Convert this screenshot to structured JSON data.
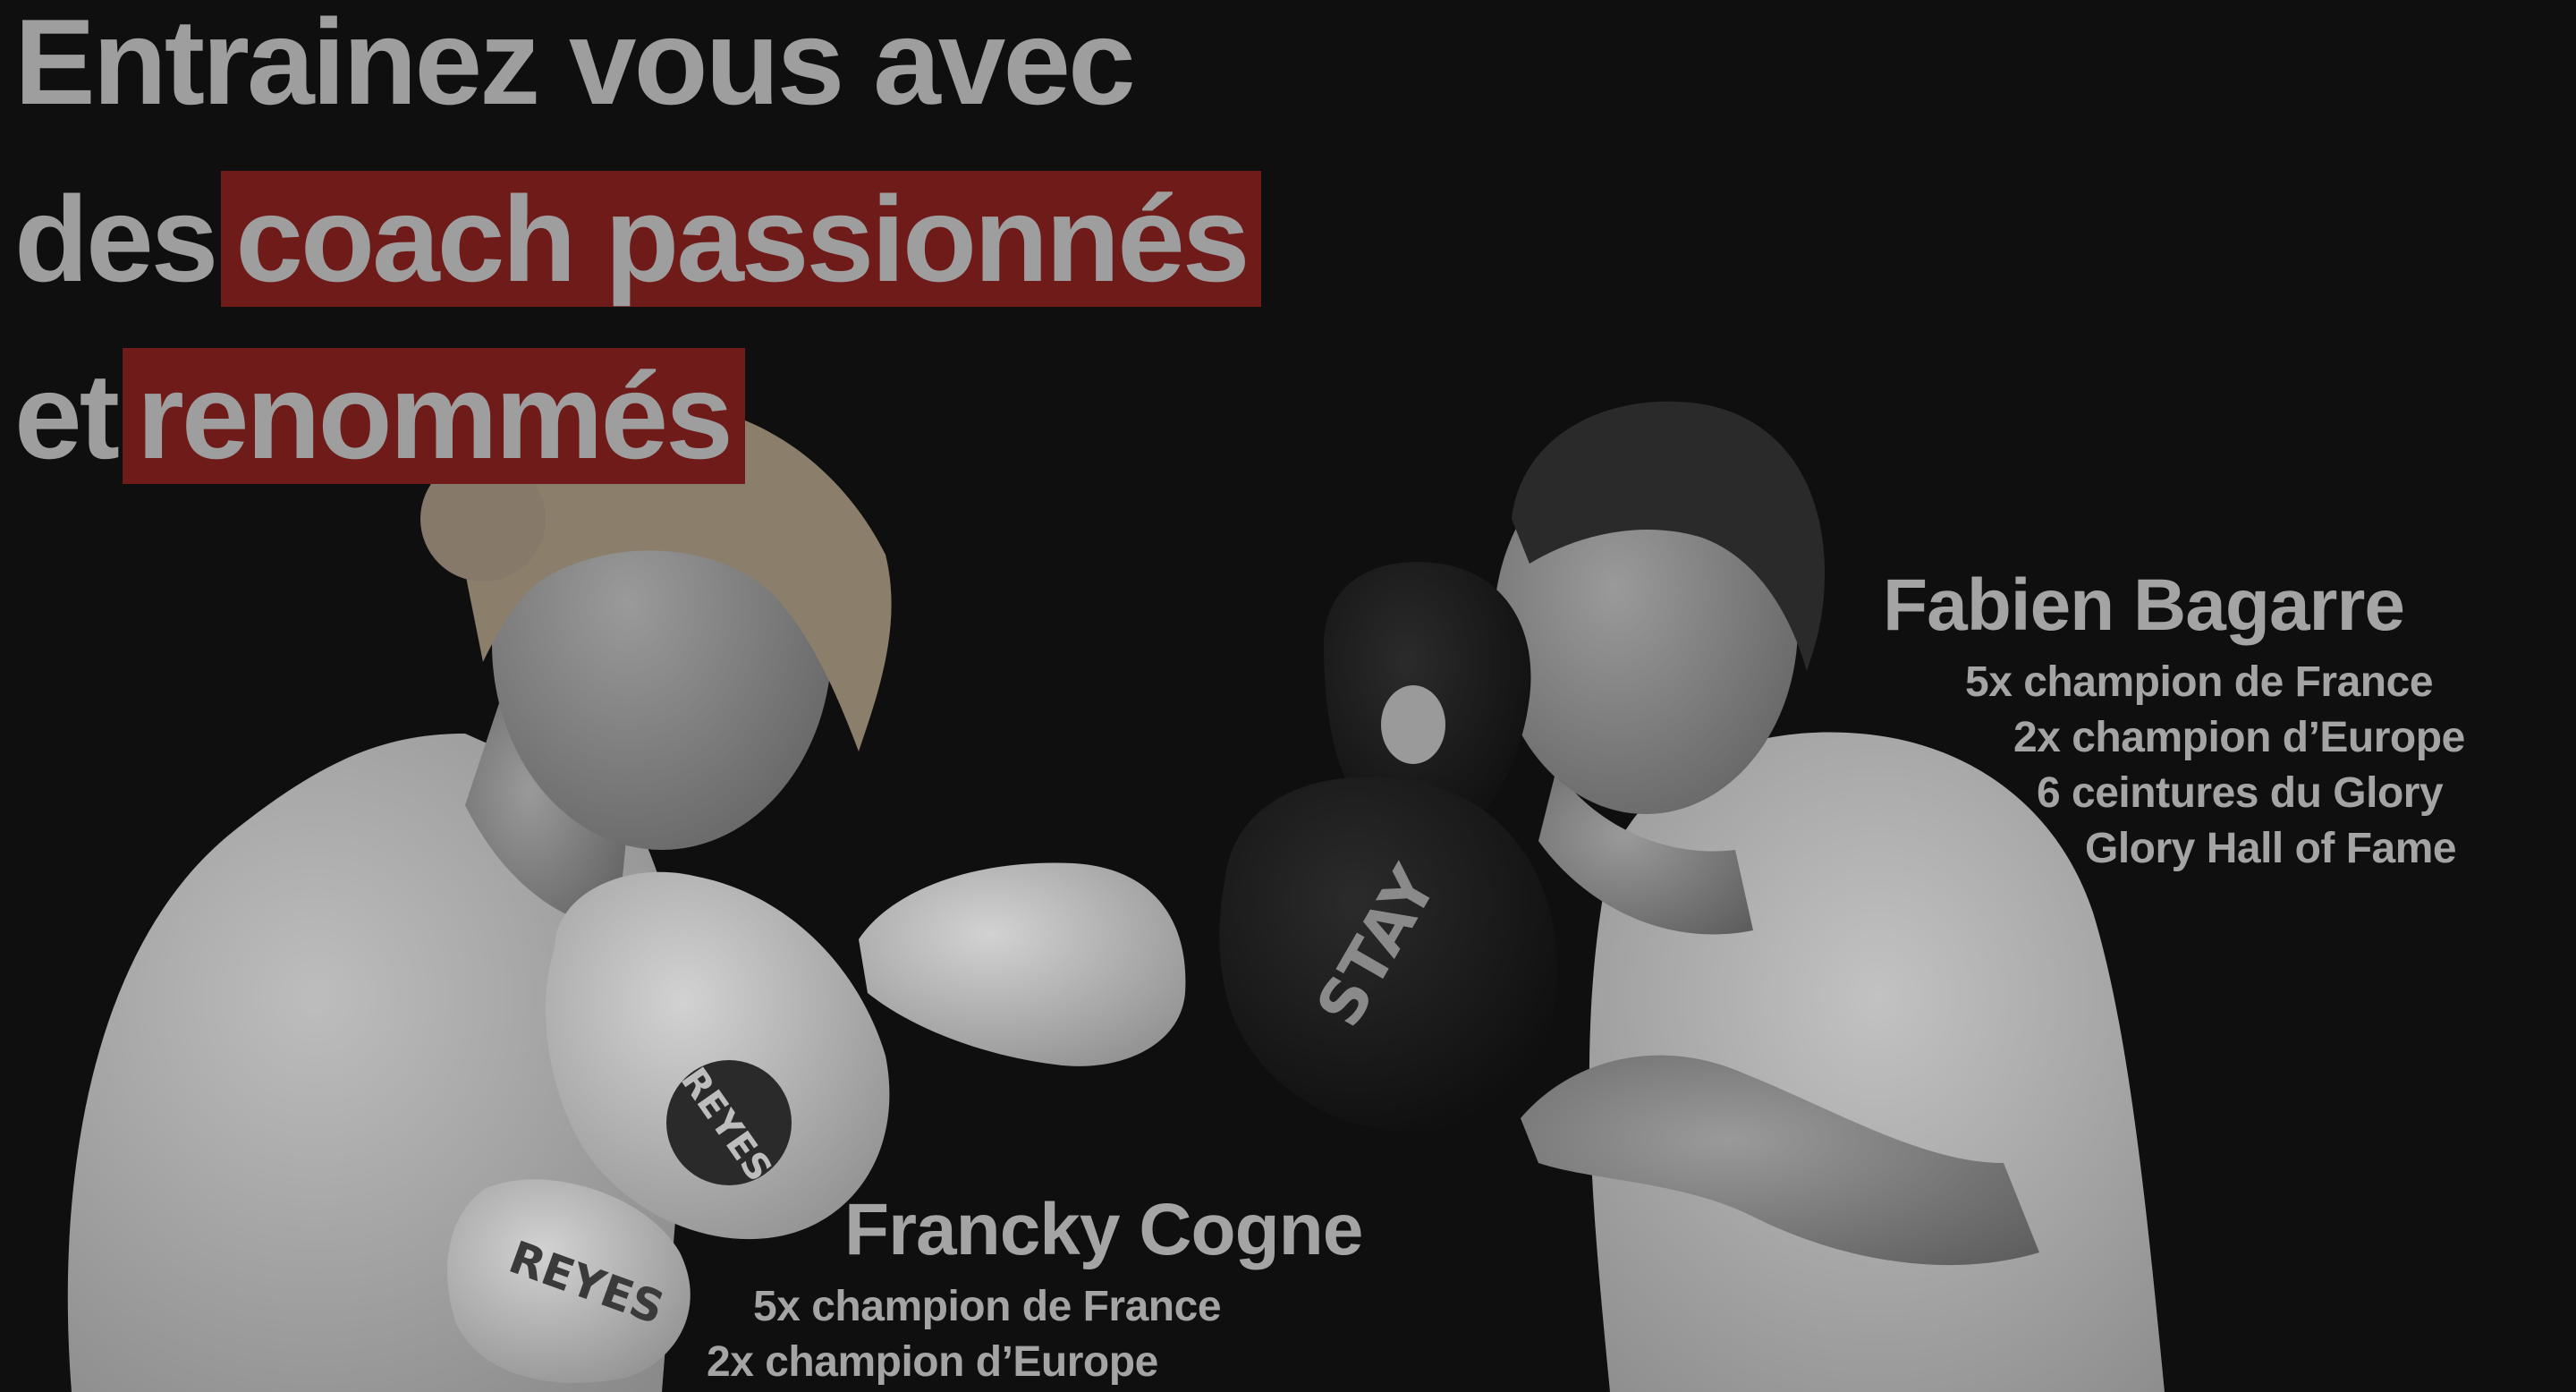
{
  "headline": {
    "line1": "Entrainez vous avec",
    "line2_prefix": "des",
    "line2_highlight": "coach passionnés",
    "line3_prefix": "et",
    "line3_highlight": "renommés"
  },
  "coaches": {
    "fabien": {
      "name": "Fabien Bagarre",
      "titles": [
        "5x champion de France",
        "2x champion d’Europe",
        "6 ceintures du Glory",
        "Glory Hall of Fame"
      ]
    },
    "francky": {
      "name": "Francky Cogne",
      "titles": [
        "5x champion de France",
        "2x champion d’Europe"
      ]
    }
  },
  "equipment": {
    "left_glove_brand": "REYES",
    "pad_brand": "STAY"
  },
  "colors": {
    "background": "#0f0f10",
    "highlight": "#6f1b1a",
    "text": "#9e9e9e"
  }
}
